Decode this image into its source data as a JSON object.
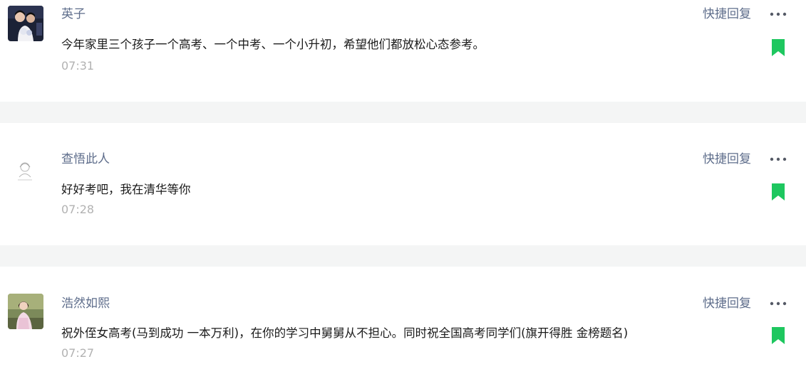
{
  "colors": {
    "name": "#5e6d8b",
    "time": "#b2b2b2",
    "text": "#1a1a1a",
    "bookmark": "#1ec75f",
    "separator": "#f4f5f5"
  },
  "comments": [
    {
      "username": "英子",
      "text": "今年家里三个孩子一个高考、一个中考、一个小升初，希望他们都放松心态参考。",
      "time": "07:31",
      "reply_label": "快捷回复",
      "more_icon": "more-horizontal-icon",
      "bookmark_icon": "bookmark-icon"
    },
    {
      "username": "查悟此人",
      "text": "好好考吧，我在清华等你",
      "time": "07:28",
      "reply_label": "快捷回复",
      "more_icon": "more-horizontal-icon",
      "bookmark_icon": "bookmark-icon"
    },
    {
      "username": "浩然如熙",
      "text": "祝外侄女高考(马到成功 一本万利)，在你的学习中舅舅从不担心。同时祝全国高考同学们(旗开得胜 金榜题名)",
      "time": "07:27",
      "reply_label": "快捷回复",
      "more_icon": "more-horizontal-icon",
      "bookmark_icon": "bookmark-icon"
    }
  ]
}
